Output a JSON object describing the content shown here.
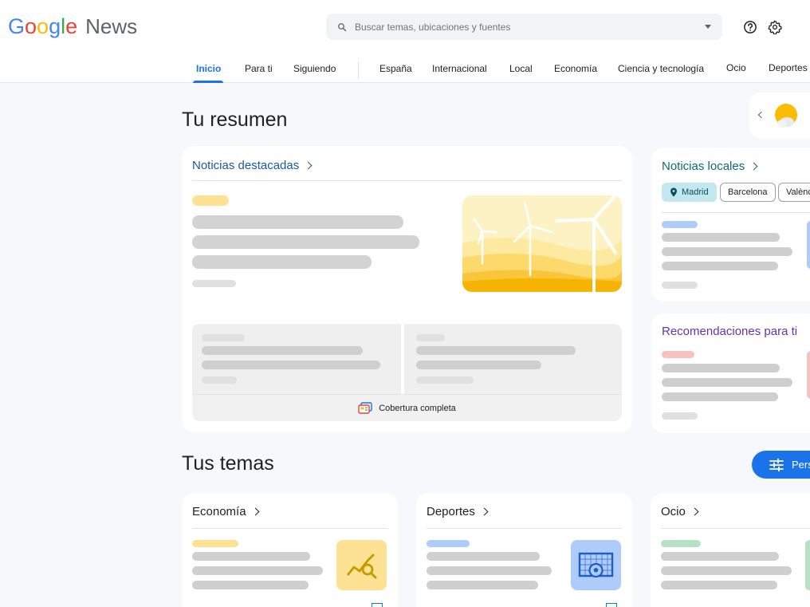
{
  "app": {
    "logo_text": "Google",
    "logo_suffix": "News"
  },
  "search": {
    "placeholder": "Buscar temas, ubicaciones y fuentes"
  },
  "icons": {
    "search": "search-icon",
    "help": "help-circle-icon",
    "settings": "gear-icon"
  },
  "tabs": [
    {
      "label": "Inicio",
      "active": true
    },
    {
      "label": "Para ti"
    },
    {
      "label": "Siguiendo"
    },
    {
      "label": "España"
    },
    {
      "label": "Internacional"
    },
    {
      "label": "Local"
    },
    {
      "label": "Economía"
    },
    {
      "label": "Ciencia y tecnología"
    },
    {
      "label": "Ocio"
    },
    {
      "label": "Deportes"
    }
  ],
  "summary": {
    "title": "Tu resumen",
    "top_stories": {
      "heading": "Noticias destacadas",
      "coverage_label": "Cobertura completa"
    },
    "local": {
      "heading": "Noticias locales",
      "chips": [
        "Madrid",
        "Barcelona",
        "Valènc"
      ]
    },
    "recommended": {
      "heading": "Recomendaciones para ti"
    }
  },
  "topics": {
    "title": "Tus temas",
    "personalize_label": "Pers",
    "cards": [
      {
        "heading": "Economía"
      },
      {
        "heading": "Deportes"
      },
      {
        "heading": "Ocio"
      }
    ]
  },
  "colors": {
    "accent": "#1a73e8",
    "background": "#f6f8fc",
    "placeholder_yellow": "#fde293",
    "placeholder_blue": "#aecbfa",
    "placeholder_red": "#f6c2bd",
    "placeholder_green": "#b7e1c3"
  }
}
